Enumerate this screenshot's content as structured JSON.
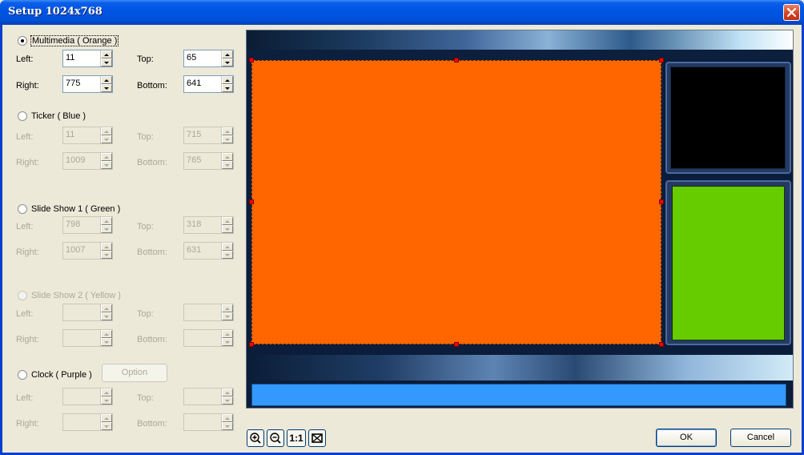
{
  "window": {
    "title": "Setup 1024x768"
  },
  "sections": [
    {
      "label": "Multimedia ( Orange )",
      "checked": true,
      "enabled": true,
      "left_label": "Left:",
      "left": "11",
      "top_label": "Top:",
      "top": "65",
      "right_label": "Right:",
      "right": "775",
      "bottom_label": "Bottom:",
      "bottom": "641"
    },
    {
      "label": "Ticker ( Blue )",
      "checked": false,
      "enabled": true,
      "left_label": "Left:",
      "left": "11",
      "top_label": "Top:",
      "top": "715",
      "right_label": "Right:",
      "right": "1009",
      "bottom_label": "Bottom:",
      "bottom": "765"
    },
    {
      "label": "Slide Show 1 ( Green )",
      "checked": false,
      "enabled": true,
      "left_label": "Left:",
      "left": "798",
      "top_label": "Top:",
      "top": "318",
      "right_label": "Right:",
      "right": "1007",
      "bottom_label": "Bottom:",
      "bottom": "631"
    },
    {
      "label": "Slide Show 2 ( Yellow )",
      "checked": false,
      "enabled": false,
      "left_label": "Left:",
      "left": "",
      "top_label": "Top:",
      "top": "",
      "right_label": "Right:",
      "right": "",
      "bottom_label": "Bottom:",
      "bottom": ""
    },
    {
      "label": "Clock ( Purple )",
      "checked": false,
      "enabled": true,
      "left_label": "Left:",
      "left": "",
      "top_label": "Top:",
      "top": "",
      "right_label": "Right:",
      "right": "",
      "bottom_label": "Bottom:",
      "bottom": ""
    }
  ],
  "clock_option_label": "Option",
  "toolbar": {
    "zoom_in_icon": "zoom-in-icon",
    "zoom_out_icon": "zoom-out-icon",
    "actual_size_label": "1:1",
    "fit_icon": "fit-window-icon"
  },
  "buttons": {
    "ok": "OK",
    "cancel": "Cancel"
  },
  "colors": {
    "multimedia": "#ff6600",
    "ticker": "#3399ff",
    "slideshow1": "#66cc00",
    "black_panel": "#000000"
  }
}
